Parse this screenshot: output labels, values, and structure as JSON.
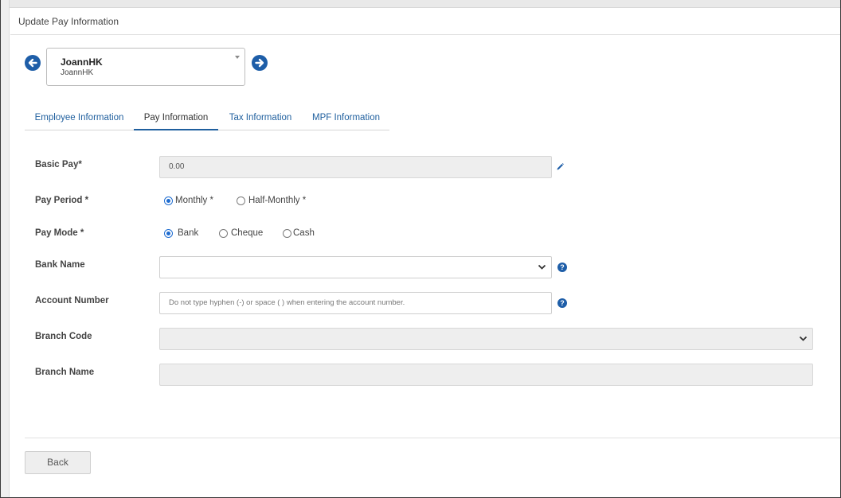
{
  "panel": {
    "title": "Update Pay Information"
  },
  "employee": {
    "name": "JoannHK",
    "sub": "JoannHK"
  },
  "tabs": [
    {
      "label": "Employee Information",
      "active": false
    },
    {
      "label": "Pay Information",
      "active": true
    },
    {
      "label": "Tax Information",
      "active": false
    },
    {
      "label": "MPF Information",
      "active": false
    }
  ],
  "form": {
    "basic_pay": {
      "label": "Basic Pay*",
      "value": "0.00"
    },
    "pay_period": {
      "label": "Pay Period *",
      "options": [
        "Monthly *",
        "Half-Monthly *"
      ],
      "selected": "Monthly *"
    },
    "pay_mode": {
      "label": "Pay Mode *",
      "options": [
        "Bank",
        "Cheque",
        "Cash"
      ],
      "selected": "Bank"
    },
    "bank_name": {
      "label": "Bank Name",
      "value": ""
    },
    "account_number": {
      "label": "Account Number",
      "placeholder": "Do not type hyphen (-) or space ( ) when entering the account number."
    },
    "branch_code": {
      "label": "Branch Code",
      "value": ""
    },
    "branch_name": {
      "label": "Branch Name",
      "value": ""
    }
  },
  "footer": {
    "back_label": "Back"
  },
  "colors": {
    "accent": "#1f5f9e",
    "icon_blue": "#1e5ea8",
    "radio_blue": "#1e6cd0",
    "disabled_bg": "#eeeeee"
  },
  "icons": [
    "arrow-left-circle-icon",
    "arrow-right-circle-icon",
    "pencil-icon",
    "help-icon",
    "chevron-down-icon",
    "caret-down-icon"
  ]
}
